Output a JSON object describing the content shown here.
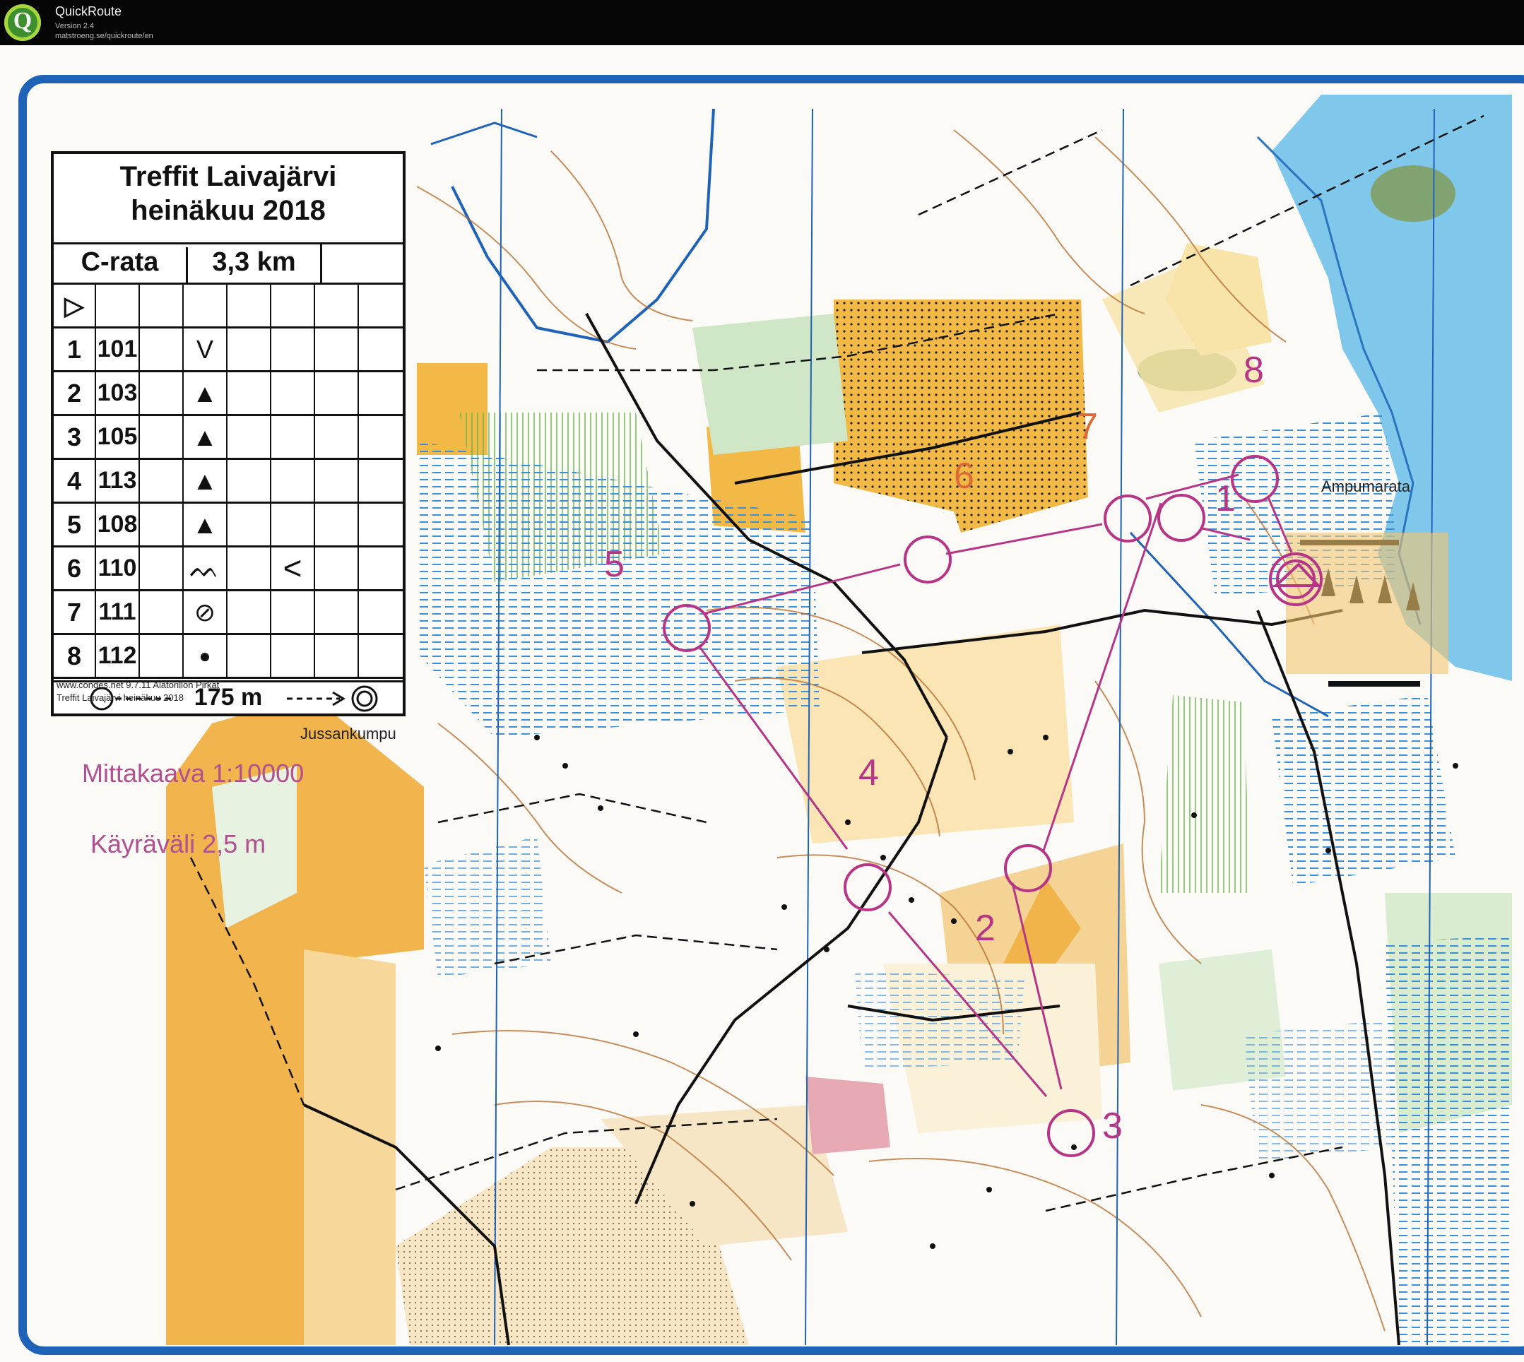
{
  "app": {
    "name": "QuickRoute",
    "version": "Version 2.4",
    "url": "matstroeng.se/quickroute/en",
    "logo_letter": "Q"
  },
  "description_sheet": {
    "title_line1": "Treffit Laivajärvi",
    "title_line2": "heinäkuu 2018",
    "course_name": "C-rata",
    "course_length": "3,3 km",
    "start_symbol": "▷",
    "controls": [
      {
        "num": "1",
        "code": "101",
        "symbol": "V",
        "extra": ""
      },
      {
        "num": "2",
        "code": "103",
        "symbol": "▲",
        "extra": ""
      },
      {
        "num": "3",
        "code": "105",
        "symbol": "▲",
        "extra": ""
      },
      {
        "num": "4",
        "code": "113",
        "symbol": "▲",
        "extra": ""
      },
      {
        "num": "5",
        "code": "108",
        "symbol": "▲",
        "extra": ""
      },
      {
        "num": "6",
        "code": "110",
        "symbol": "ᨓ",
        "extra": "<"
      },
      {
        "num": "7",
        "code": "111",
        "symbol": "⊘",
        "extra": ""
      },
      {
        "num": "8",
        "code": "112",
        "symbol": "●",
        "extra": ""
      }
    ],
    "finish_distance": "175 m",
    "credit_line1": "www.condes.net 9.7.11 Alatorillon Pirkat",
    "credit_line2": "Treffit Laivajärvi heinäkuu 2018"
  },
  "map": {
    "scale_label": "Mittakaava 1:10000",
    "contour_label": "Käyräväli 2,5 m",
    "place_names": [
      "Jussankumpu",
      "Ampumarata"
    ],
    "course_color": "#b73586",
    "control_labels": [
      "1",
      "2",
      "3",
      "4",
      "5",
      "6",
      "7",
      "8"
    ]
  }
}
